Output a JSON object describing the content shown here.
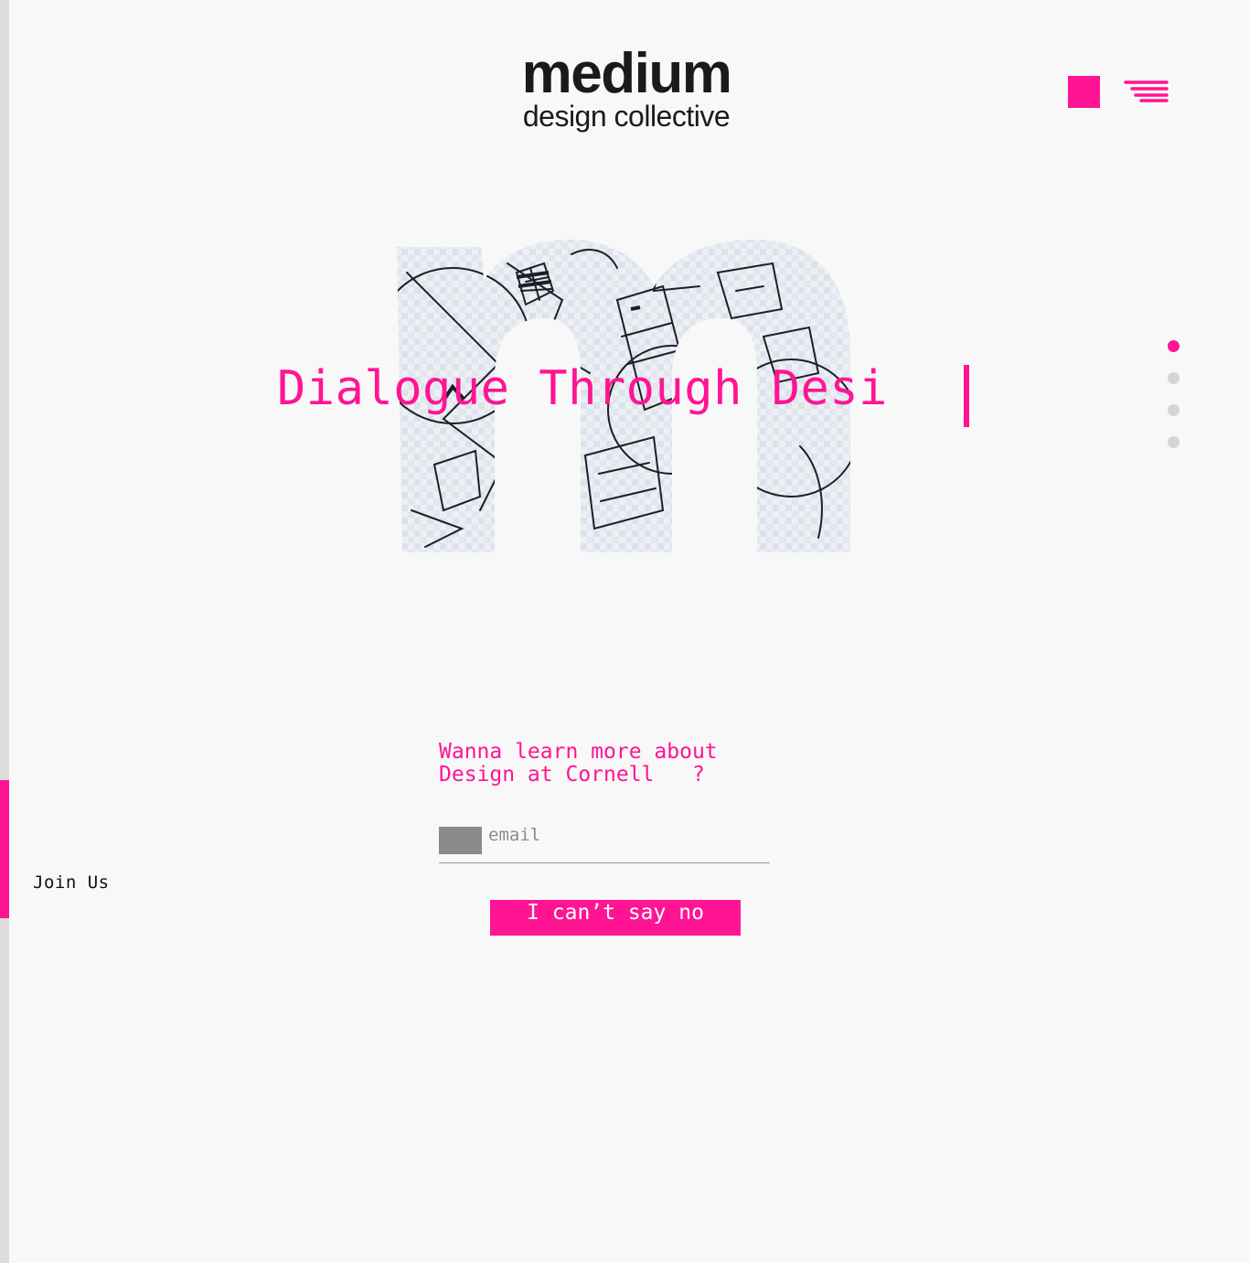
{
  "brand": {
    "name": "medium",
    "tagline": "design collective"
  },
  "colors": {
    "accent": "#ff1493",
    "rail": "#dcdcdc",
    "background": "#f8f8f8",
    "inactive_dot": "#d4d4d4"
  },
  "header": {
    "square_icon": "square-icon",
    "menu_icon": "hamburger-menu-icon"
  },
  "hero": {
    "headline": "Dialogue Through Desi",
    "slide_count": 4,
    "active_slide": 1
  },
  "sidebar": {
    "join_label": "Join Us"
  },
  "signup": {
    "prompt": "Wanna learn more about\nDesign at Cornell   ?",
    "email_placeholder": "email",
    "submit_label": "I can’t say no"
  }
}
